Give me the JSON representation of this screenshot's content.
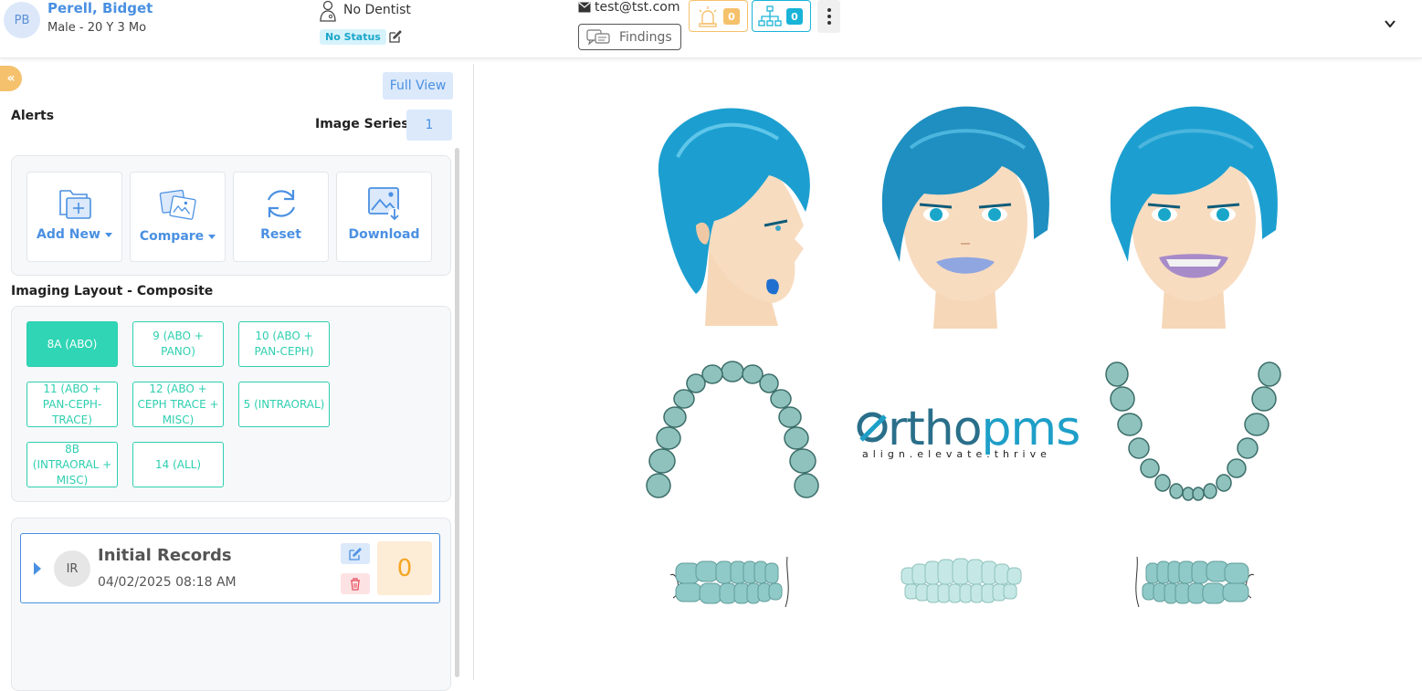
{
  "patient": {
    "initials": "PB",
    "name": "Perell, Bidget",
    "demographics": "Male - 20 Y 3 Mo",
    "dentist": "No Dentist",
    "status": "No Status",
    "email": "test@tst.com"
  },
  "header": {
    "findings_label": "Findings",
    "alert_count": "0",
    "tree_count": "0"
  },
  "left_panel": {
    "collapse_glyph": "«",
    "full_view_label": "Full View",
    "alerts_label": "Alerts",
    "image_series_label": "Image Series",
    "image_series_count": "1",
    "tools": {
      "add_new": "Add New",
      "compare": "Compare",
      "reset": "Reset",
      "download": "Download"
    },
    "layout_title": "Imaging Layout - Composite",
    "layouts": [
      "8A (ABO)",
      "9 (ABO + PANO)",
      "10 (ABO + PAN-CEPH)",
      "11 (ABO + PAN-CEPH-TRACE)",
      "12 (ABO + CEPH TRACE + MISC)",
      "5 (INTRAORAL)",
      "8B (INTRAORAL + MISC)",
      "14 (ALL)"
    ],
    "active_layout": "8A (ABO)",
    "record": {
      "initials": "IR",
      "title": "Initial Records",
      "date": "04/02/2025 08:18 AM",
      "count": "0"
    }
  },
  "composite": {
    "logo_main": "rtho",
    "logo_accent": "pms",
    "tagline": "align.elevate.thrive"
  },
  "colors": {
    "primary": "#4a90e2",
    "teal": "#2ecfb0",
    "warning": "#f5c16c",
    "cyan": "#1ab3d8",
    "hair": "#1e9fc8"
  }
}
